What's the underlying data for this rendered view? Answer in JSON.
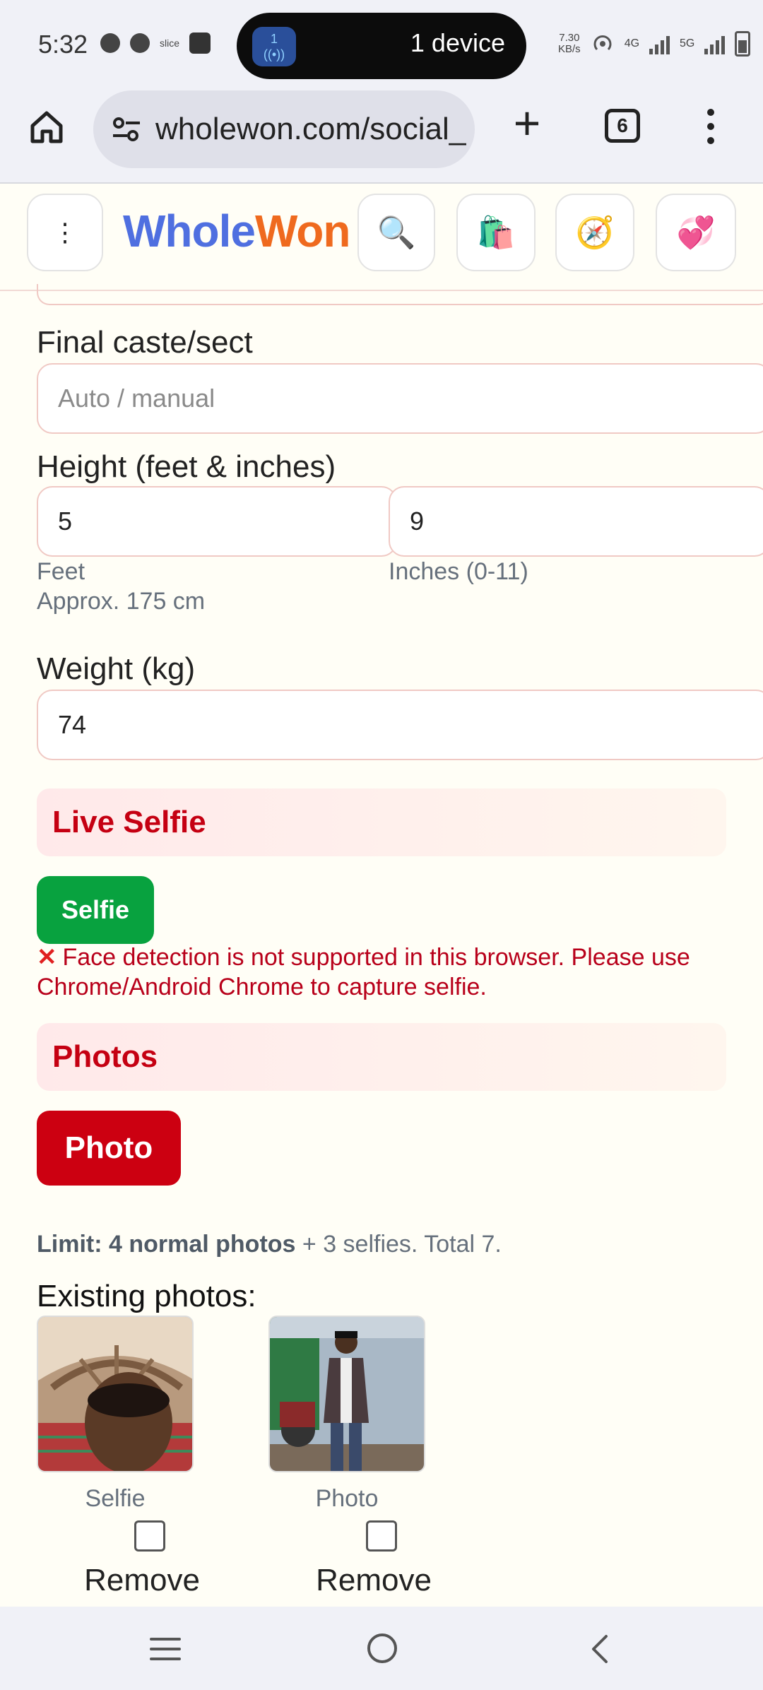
{
  "status_bar": {
    "time": "5:32",
    "slice_label": "slice",
    "island_badge": "1",
    "island_text": "1 device",
    "speed_value": "7.30",
    "speed_unit": "KB/s",
    "net1": "4G",
    "net2": "5G"
  },
  "browser": {
    "url": "wholewon.com/social_",
    "tab_count": "6"
  },
  "site_header": {
    "logo_part1": "Whole",
    "logo_part2": "Won",
    "menu_icon": "⋮",
    "search_icon": "🔍",
    "shop_icon": "🛍️",
    "explore_icon": "🧭",
    "hearts_icon": "💞"
  },
  "form": {
    "caste": {
      "label": "Final caste/sect",
      "placeholder": "Auto / manual"
    },
    "height": {
      "label": "Height (feet & inches)",
      "feet_value": "5",
      "inches_value": "9",
      "feet_hint": "Feet",
      "inches_hint": "Inches (0-11)",
      "approx": "Approx. 175 cm"
    },
    "weight": {
      "label": "Weight (kg)",
      "value": "74"
    },
    "live_selfie": {
      "title": "Live Selfie",
      "button": "Selfie",
      "error_icon": "✕",
      "error_text": "Face detection is not supported in this browser. Please use Chrome/Android Chrome to capture selfie."
    },
    "photos": {
      "title": "Photos",
      "button": "Photo",
      "limit_strong": "Limit: 4 normal photos",
      "limit_rest": " + 3 selfies. Total 7."
    },
    "existing": {
      "title": "Existing photos:",
      "items": [
        {
          "caption": "Selfie",
          "remove_label": "Remove"
        },
        {
          "caption": "Photo",
          "remove_label": "Remove"
        }
      ]
    }
  },
  "colors": {
    "accent_red": "#cc0011",
    "accent_green": "#08a23f",
    "logo_blue": "#4f6fe0",
    "logo_orange": "#ef6a1e"
  }
}
